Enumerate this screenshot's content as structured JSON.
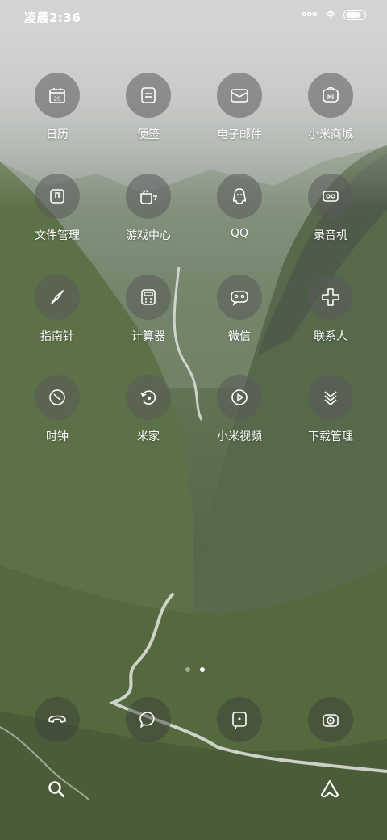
{
  "status_bar": {
    "time": "凌晨2:36",
    "signal": "ooo"
  },
  "grid": [
    {
      "label": "日历",
      "icon": "calendar-icon",
      "badge": "29"
    },
    {
      "label": "便签",
      "icon": "notes-icon"
    },
    {
      "label": "电子邮件",
      "icon": "mail-icon"
    },
    {
      "label": "小米商城",
      "icon": "mi-store-icon",
      "badge": "MI"
    },
    {
      "label": "文件管理",
      "icon": "file-manager-icon"
    },
    {
      "label": "游戏中心",
      "icon": "game-center-icon"
    },
    {
      "label": "QQ",
      "icon": "qq-icon"
    },
    {
      "label": "录音机",
      "icon": "recorder-icon"
    },
    {
      "label": "指南针",
      "icon": "compass-icon"
    },
    {
      "label": "计算器",
      "icon": "calculator-icon"
    },
    {
      "label": "微信",
      "icon": "wechat-icon"
    },
    {
      "label": "联系人",
      "icon": "contacts-icon"
    },
    {
      "label": "时钟",
      "icon": "clock-icon"
    },
    {
      "label": "米家",
      "icon": "mijia-icon"
    },
    {
      "label": "小米视频",
      "icon": "mi-video-icon"
    },
    {
      "label": "下载管理",
      "icon": "download-icon"
    }
  ],
  "dock": [
    {
      "icon": "phone-icon"
    },
    {
      "icon": "messages-icon"
    },
    {
      "icon": "browser-icon"
    },
    {
      "icon": "camera-icon"
    }
  ],
  "pages": {
    "count": 2,
    "current": 2
  },
  "bottom": {
    "left_icon": "search-icon",
    "right_icon": "assistant-icon"
  }
}
